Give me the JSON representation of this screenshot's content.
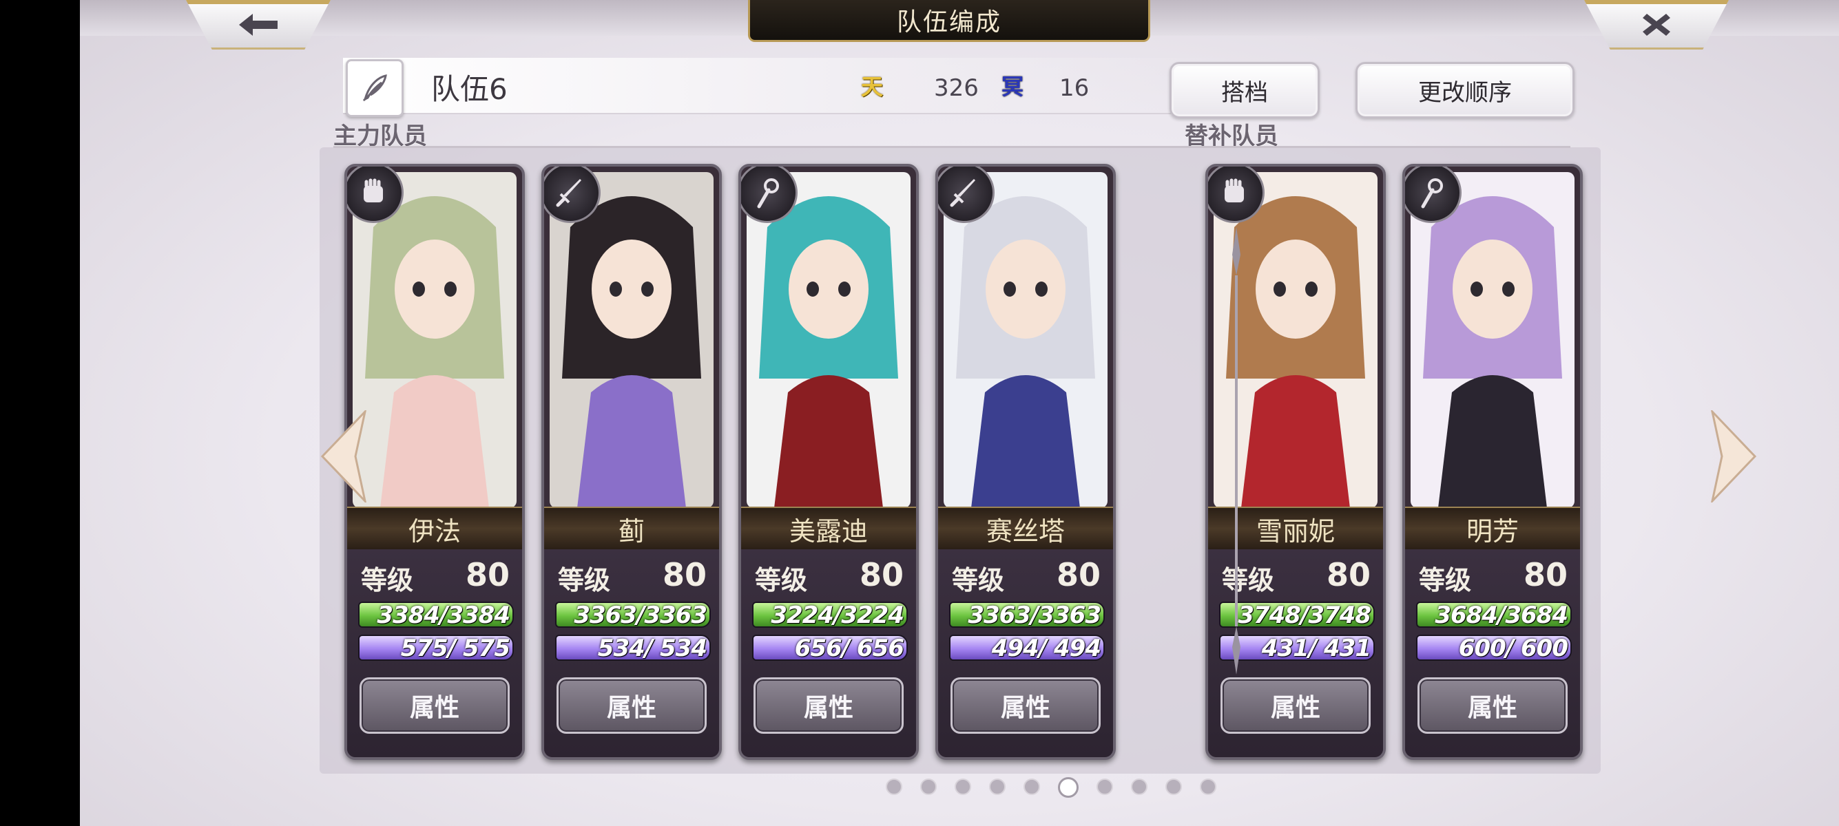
{
  "window_title": "队伍编成",
  "header": {
    "back_icon": "arrow-left-icon",
    "close_icon": "close-icon"
  },
  "team": {
    "name": "队伍6",
    "heaven_symbol": "天",
    "heaven_value": "326",
    "underworld_symbol": "冥",
    "underworld_value": "16"
  },
  "buttons": {
    "partner": "搭档",
    "change_order": "更改顺序"
  },
  "sections": {
    "main": "主力队员",
    "sub": "替补队员"
  },
  "level_label": "等级",
  "attribute_label": "属性",
  "main_members": [
    {
      "name": "伊法",
      "role": "fist-icon",
      "level": "80",
      "hp": "3384/3384",
      "mp": " 575/ 575",
      "hp_fill": 1,
      "mp_fill": 1,
      "palette": [
        "#e8e6e0",
        "#b8c39a",
        "#f1cbc6"
      ]
    },
    {
      "name": "蓟",
      "role": "sword-icon",
      "level": "80",
      "hp": "3363/3363",
      "mp": " 534/ 534",
      "hp_fill": 1,
      "mp_fill": 1,
      "palette": [
        "#d9d4cf",
        "#2b2428",
        "#8a6fc9"
      ]
    },
    {
      "name": "美露迪",
      "role": "staff-icon",
      "level": "80",
      "hp": "3224/3224",
      "mp": " 656/ 656",
      "hp_fill": 1,
      "mp_fill": 1,
      "palette": [
        "#f2f2f2",
        "#3fb6b7",
        "#8a1e22"
      ]
    },
    {
      "name": "赛丝塔",
      "role": "sword-icon",
      "level": "80",
      "hp": "3363/3363",
      "mp": " 494/ 494",
      "hp_fill": 1,
      "mp_fill": 1,
      "palette": [
        "#eef0f5",
        "#d8d9e3",
        "#3b3f8f"
      ]
    }
  ],
  "sub_members": [
    {
      "name": "雪丽妮",
      "role": "fist-icon",
      "level": "80",
      "hp": "3748/3748",
      "mp": " 431/ 431",
      "hp_fill": 1,
      "mp_fill": 1,
      "palette": [
        "#f4ece6",
        "#b07b4e",
        "#b3262d"
      ]
    },
    {
      "name": "明芳",
      "role": "staff-icon",
      "level": "80",
      "hp": "3684/3684",
      "mp": " 600/ 600",
      "hp_fill": 1,
      "mp_fill": 1,
      "palette": [
        "#f3eef6",
        "#b89ad8",
        "#2a2530"
      ]
    }
  ],
  "pagination": {
    "total": 10,
    "current": 6
  }
}
